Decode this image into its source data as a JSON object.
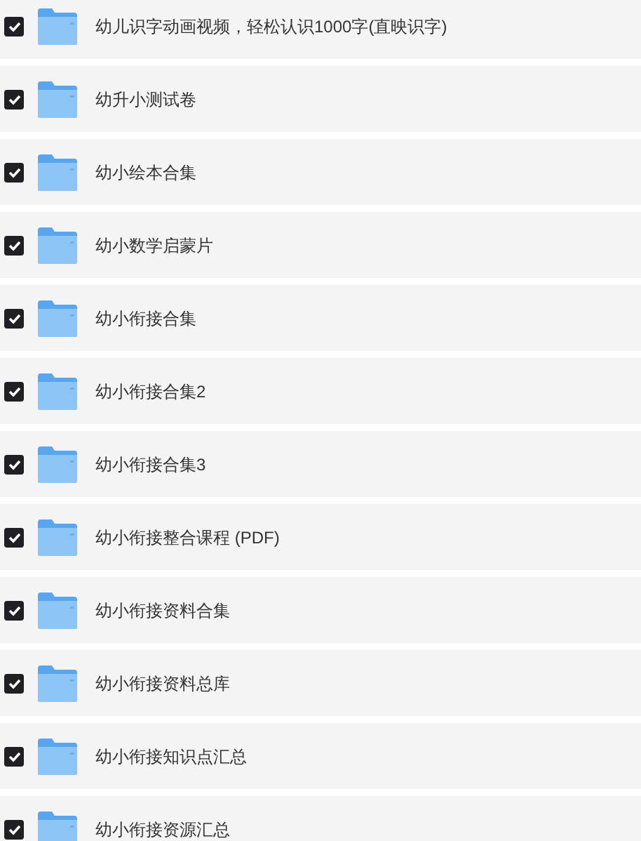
{
  "files": [
    {
      "name": "幼儿识字动画视频，轻松认识1000字(直映识字)",
      "checked": true
    },
    {
      "name": "幼升小测试卷",
      "checked": true
    },
    {
      "name": "幼小绘本合集",
      "checked": true
    },
    {
      "name": "幼小数学启蒙片",
      "checked": true
    },
    {
      "name": "幼小衔接合集",
      "checked": true
    },
    {
      "name": "幼小衔接合集2",
      "checked": true
    },
    {
      "name": "幼小衔接合集3",
      "checked": true
    },
    {
      "name": "幼小衔接整合课程 (PDF)",
      "checked": true
    },
    {
      "name": "幼小衔接资料合集",
      "checked": true
    },
    {
      "name": "幼小衔接资料总库",
      "checked": true
    },
    {
      "name": "幼小衔接知识点汇总",
      "checked": true
    },
    {
      "name": "幼小衔接资源汇总",
      "checked": true
    }
  ]
}
